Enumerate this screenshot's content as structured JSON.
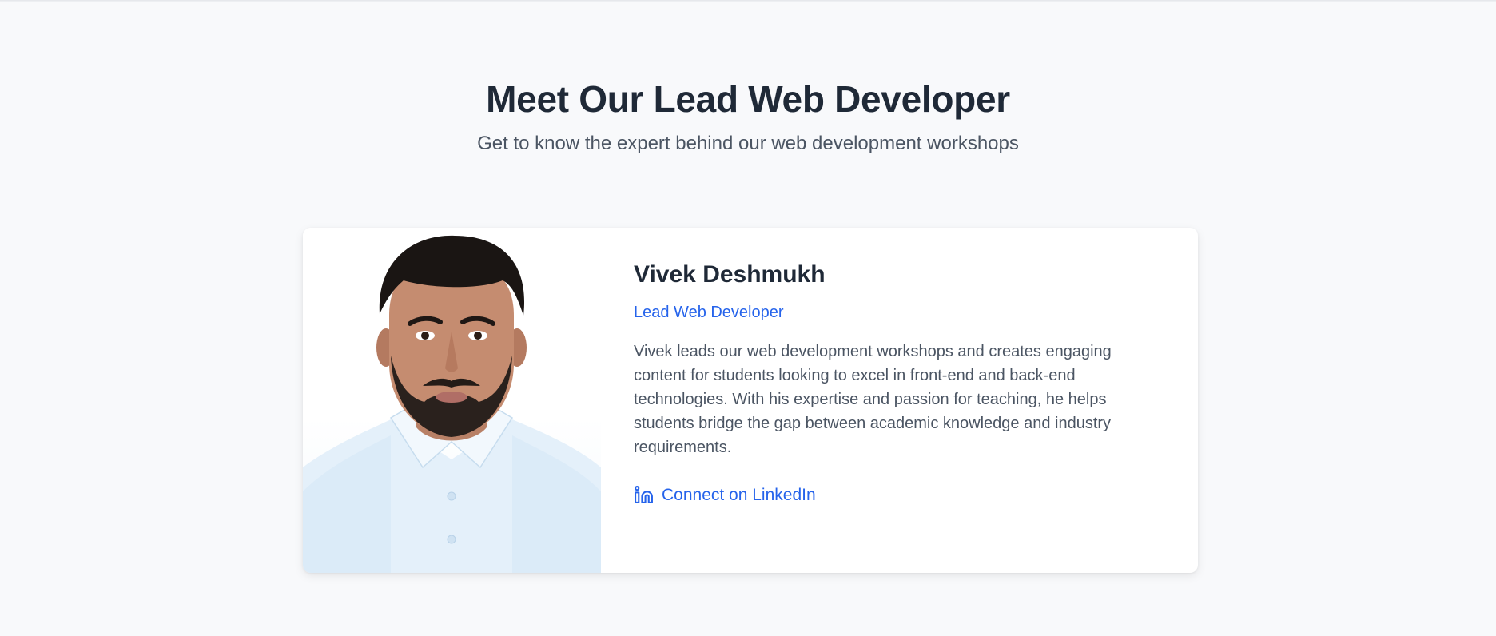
{
  "header": {
    "title": "Meet Our Lead Web Developer",
    "subtitle": "Get to know the expert behind our web development workshops"
  },
  "member": {
    "name": "Vivek Deshmukh",
    "role": "Lead Web Developer",
    "bio": "Vivek leads our web development workshops and creates engaging content for students looking to excel in front-end and back-end technologies. With his expertise and passion for teaching, he helps students bridge the gap between academic knowledge and industry requirements.",
    "photo_icon": "portrait-photo",
    "link": {
      "label": "Connect on LinkedIn",
      "icon": "linkedin-icon"
    }
  },
  "colors": {
    "background": "#f8f9fb",
    "heading": "#1f2937",
    "body_text": "#4b5563",
    "accent": "#2563eb",
    "card": "#ffffff"
  }
}
